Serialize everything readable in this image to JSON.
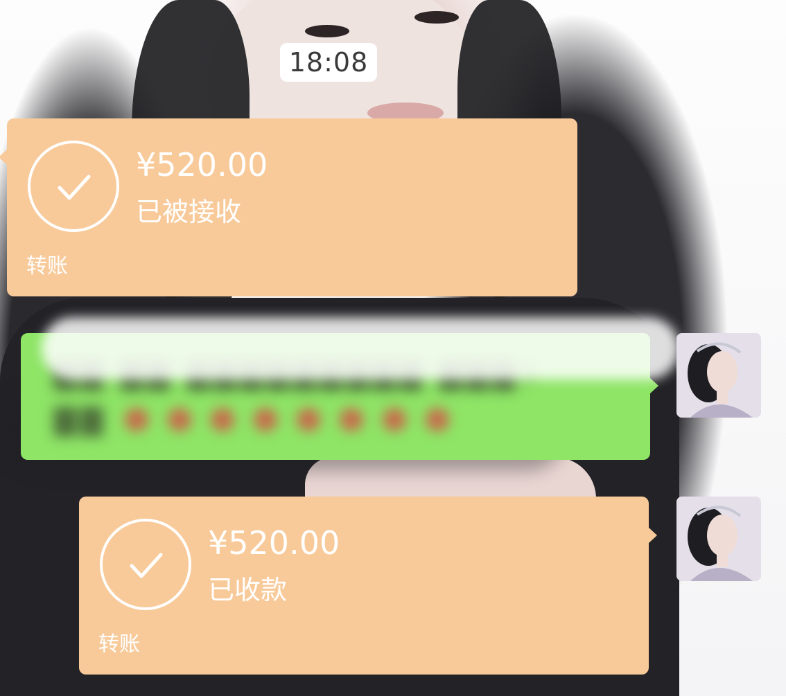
{
  "chat": {
    "timestamp": "18:08",
    "messages": [
      {
        "type": "transfer",
        "side": "left",
        "amount": "¥520.00",
        "status": "已被接收",
        "label": "转账",
        "icon": "check-circle-icon"
      },
      {
        "type": "text",
        "side": "right",
        "blurred": true,
        "bubble_color": "#8ee566"
      },
      {
        "type": "transfer",
        "side": "right",
        "amount": "¥520.00",
        "status": "已收款",
        "label": "转账",
        "icon": "check-circle-icon"
      }
    ]
  },
  "colors": {
    "transfer_card": "#f8ca9a",
    "text_bubble": "#8ee566",
    "time_pill": "#ffffff"
  }
}
